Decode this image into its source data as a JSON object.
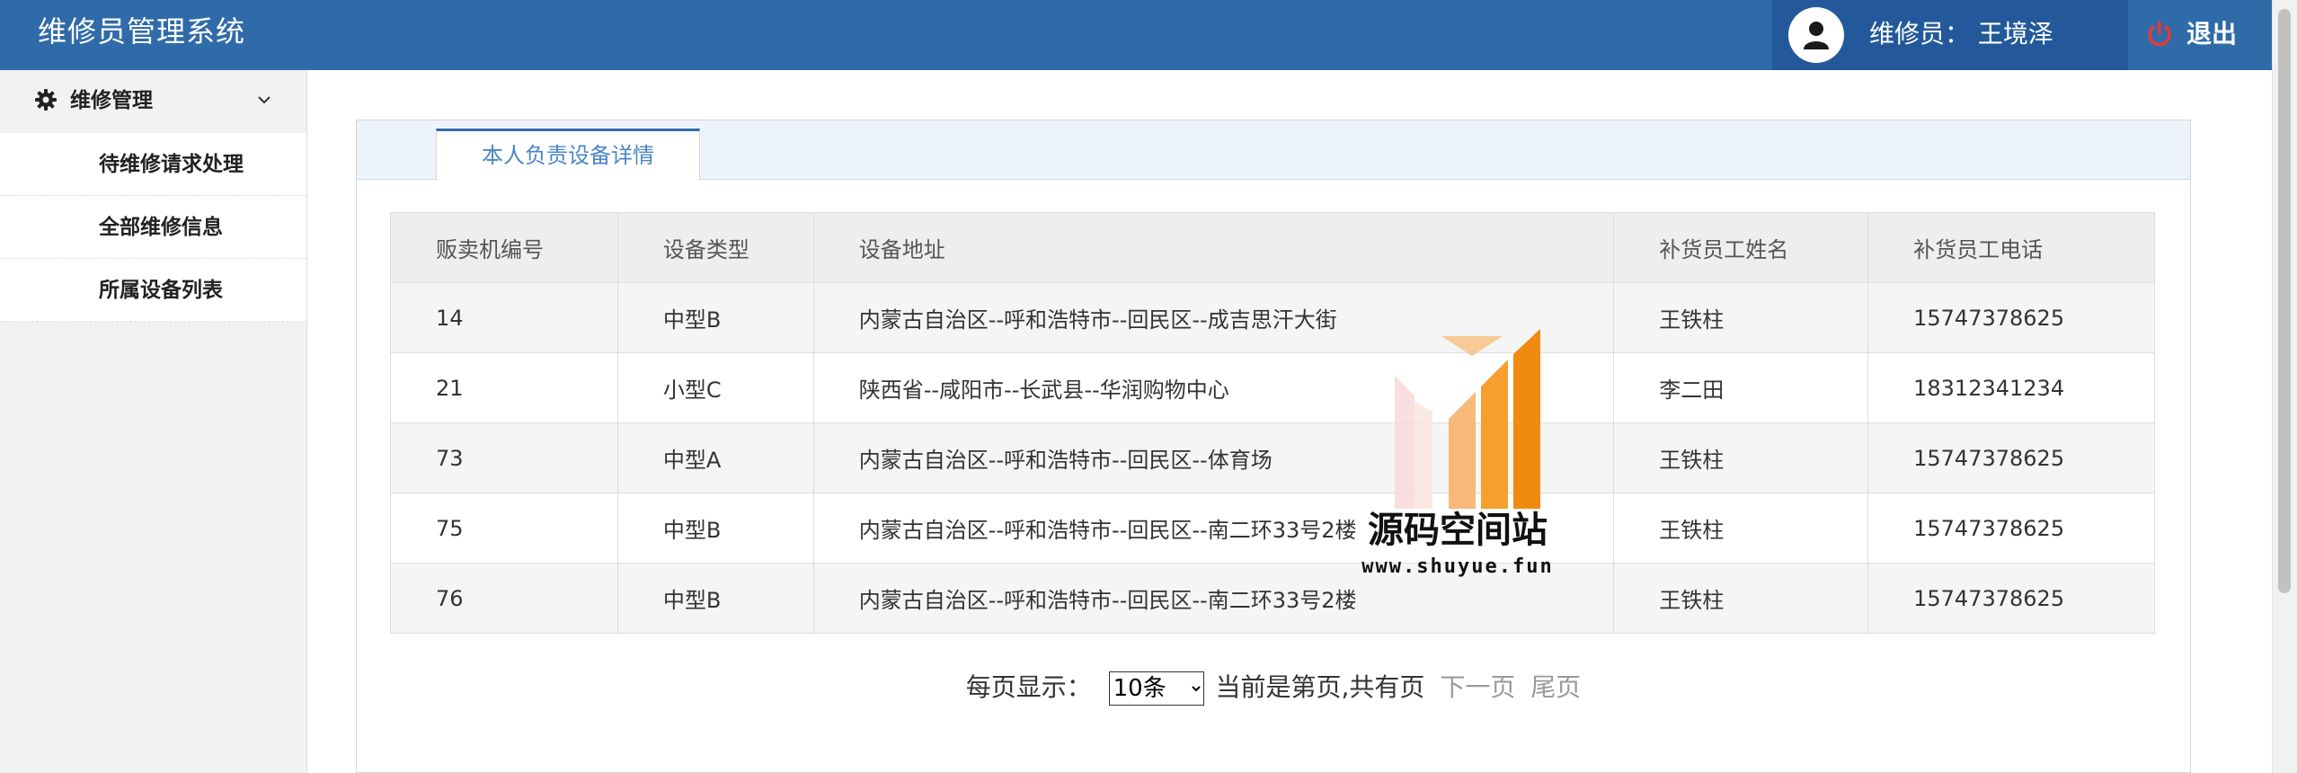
{
  "header": {
    "title": "维修员管理系统",
    "user_label": "维修员： 王境泽",
    "logout_label": "退出"
  },
  "sidebar": {
    "group_label": "维修管理",
    "items": [
      {
        "label": "待维修请求处理"
      },
      {
        "label": "全部维修信息"
      },
      {
        "label": "所属设备列表"
      }
    ]
  },
  "main": {
    "tab_label": "本人负责设备详情",
    "table": {
      "columns": [
        "贩卖机编号",
        "设备类型",
        "设备地址",
        "补货员工姓名",
        "补货员工电话"
      ],
      "rows": [
        [
          "14",
          "中型B",
          "内蒙古自治区--呼和浩特市--回民区--成吉思汗大街",
          "王铁柱",
          "15747378625"
        ],
        [
          "21",
          "小型C",
          "陕西省--咸阳市--长武县--华润购物中心",
          "李二田",
          "18312341234"
        ],
        [
          "73",
          "中型A",
          "内蒙古自治区--呼和浩特市--回民区--体育场",
          "王铁柱",
          "15747378625"
        ],
        [
          "75",
          "中型B",
          "内蒙古自治区--呼和浩特市--回民区--南二环33号2楼",
          "王铁柱",
          "15747378625"
        ],
        [
          "76",
          "中型B",
          "内蒙古自治区--呼和浩特市--回民区--南二环33号2楼",
          "王铁柱",
          "15747378625"
        ]
      ]
    },
    "pager": {
      "per_page_label": "每页显示：",
      "page_size": "10条",
      "page_info": "当前是第页,共有页",
      "next_label": "下一页",
      "last_label": "尾页"
    }
  },
  "watermark": {
    "text": "源码空间站",
    "url": "www.shuyue.fun"
  },
  "colors": {
    "header_bg": "#2f6ba8",
    "user_box_bg": "#23599a",
    "tab_accent": "#2f6ba8",
    "tab_text": "#4a86c5",
    "logout_icon": "#e53935",
    "watermark_orange": "#f59a23"
  },
  "icons": {
    "avatar": "user-icon",
    "logout": "power-icon",
    "menu_group": "gear-icon",
    "menu_toggle": "chevron-down-icon"
  }
}
